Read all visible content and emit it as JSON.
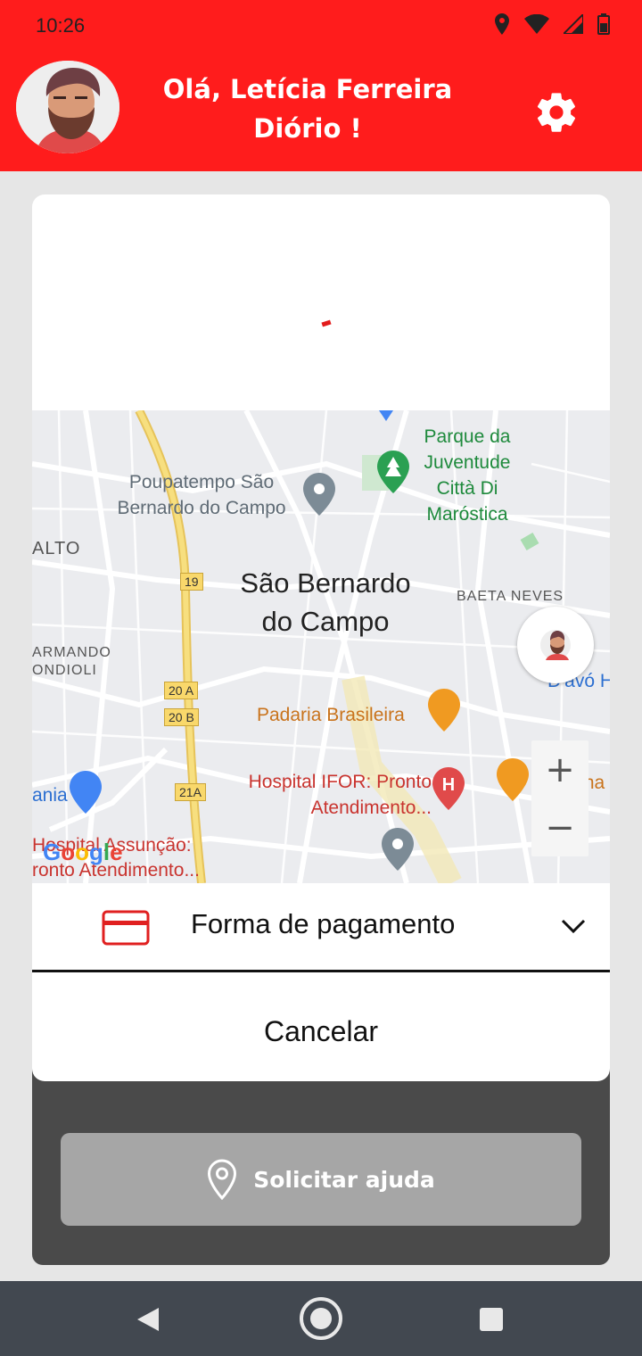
{
  "status_bar": {
    "time": "10:26"
  },
  "header": {
    "greeting": "Olá, Letícia Ferreira Diório !"
  },
  "payment": {
    "label": "Forma de pagamento"
  },
  "cancel_label": "Cancelar",
  "help_button": {
    "label": "Solicitar ajuda"
  },
  "map": {
    "labels": {
      "park": "Parque da Juventude Città Di Maróstica",
      "poupatempo": "Poupatempo São Bernardo do Campo",
      "city": "São Bernardo do Campo",
      "baeta": "BAETA NEVES",
      "alto": "ALTO",
      "armando": "ARMANDO ONDIOLI",
      "padaria": "Padaria Brasileira",
      "hospital_ifor": "Hospital IFOR: Pronto Atendimento...",
      "hospital_assuncao": "Hospital Assunção: ronto Atendimento...",
      "mcdonalds": "McDona",
      "davo": "D'avó H",
      "ania": "ania",
      "shield_19": "19",
      "shield_20a": "20 A",
      "shield_20b": "20 B",
      "shield_21a": "21A",
      "google": "Google"
    },
    "zoom_in": "+",
    "zoom_out": "−"
  },
  "colors": {
    "brand_red": "#ff1c1c",
    "dark_panel": "#4a4a4a",
    "button_gray": "#a6a6a6"
  }
}
